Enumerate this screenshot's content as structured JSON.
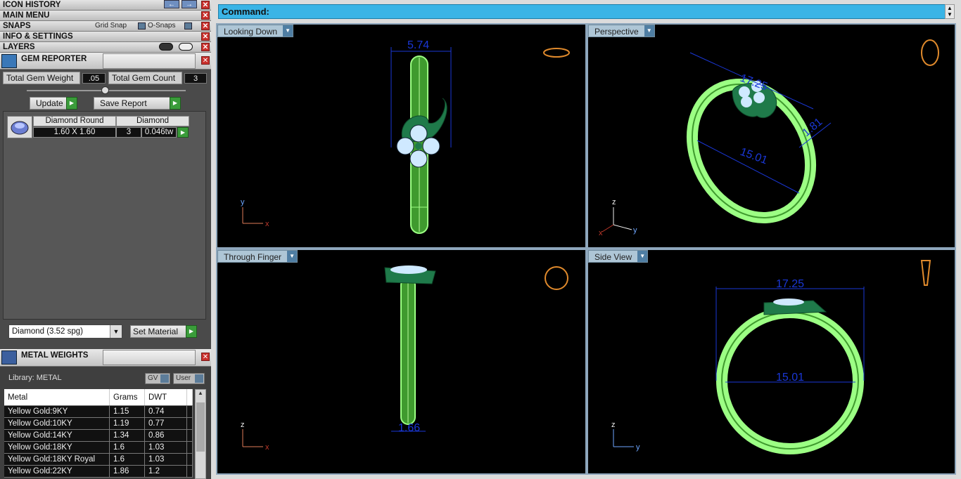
{
  "left_panel": {
    "bars": {
      "icon_history": "ICON HISTORY",
      "main_menu": "MAIN MENU",
      "snaps": "SNAPS",
      "grid_snap": "Grid Snap",
      "o_snaps": "O-Snaps",
      "info_settings": "INFO & SETTINGS",
      "layers": "LAYERS"
    },
    "gem_reporter": {
      "title": "GEM REPORTER",
      "total_weight_label": "Total Gem Weight",
      "total_weight_value": ".05",
      "total_count_label": "Total Gem Count",
      "total_count_value": "3",
      "update_label": "Update",
      "save_report_label": "Save Report",
      "gem_row": {
        "shape": "Diamond Round",
        "size": "1.60 X 1.60",
        "material": "Diamond",
        "count": "3",
        "weight": "0.046tw"
      },
      "material_select": "Diamond    (3.52 spg)",
      "set_material_label": "Set Material"
    },
    "metal_weights": {
      "title": "METAL WEIGHTS",
      "library_label": "Library: METAL",
      "gv_label": "GV",
      "user_label": "User",
      "columns": [
        "Metal",
        "Grams",
        "DWT"
      ],
      "rows": [
        [
          "Yellow Gold:9KY",
          "1.15",
          "0.74"
        ],
        [
          "Yellow Gold:10KY",
          "1.19",
          "0.77"
        ],
        [
          "Yellow Gold:14KY",
          "1.34",
          "0.86"
        ],
        [
          "Yellow Gold:18KY",
          "1.6",
          "1.03"
        ],
        [
          "Yellow Gold:18KY Royal",
          "1.6",
          "1.03"
        ],
        [
          "Yellow Gold:22KY",
          "1.86",
          "1.2"
        ]
      ]
    }
  },
  "command": {
    "label": "Command:"
  },
  "viewports": {
    "top_left": {
      "label": "Looking Down",
      "dim": "5.74",
      "ax1": "y",
      "ax2": "x"
    },
    "top_right": {
      "label": "Perspective",
      "dim1": "17.25",
      "dim2": "15.01",
      "dim3": "1.81",
      "ax1": "z",
      "ax2": "y",
      "ax3": "x"
    },
    "bottom_left": {
      "label": "Through Finger",
      "dim": "1.66",
      "ax1": "z",
      "ax2": "x"
    },
    "bottom_right": {
      "label": "Side View",
      "dim1": "17.25",
      "dim2": "15.01",
      "ax1": "z",
      "ax2": "y"
    }
  },
  "colors": {
    "command_bar": "#3ab4e6",
    "ring_metal": "#8af27a",
    "gem_green": "#1f7a4a",
    "dimension": "#1a37d6"
  }
}
